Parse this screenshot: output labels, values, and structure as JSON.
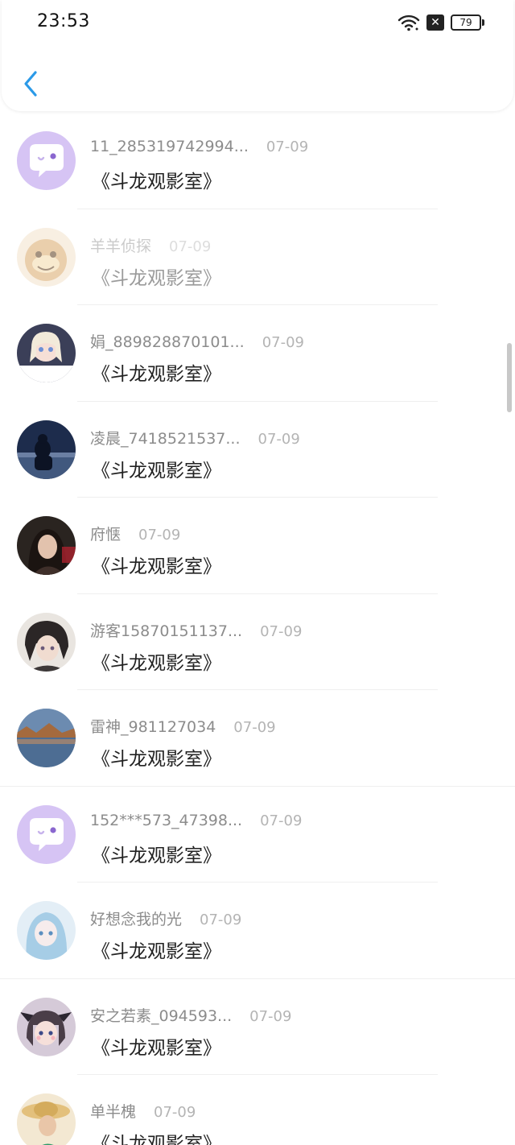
{
  "status_bar": {
    "time": "23:53",
    "battery": "79",
    "sim_mark": "✕"
  },
  "header": {
    "back_icon": "chevron-left-icon"
  },
  "items": [
    {
      "username": "11_285319742994...",
      "date": "07-09",
      "message": "《斗龙观影室》",
      "avatar": "chat-bubble"
    },
    {
      "username": "羊羊侦探",
      "date": "07-09",
      "message": "《斗龙观影室》",
      "avatar": "cartoon"
    },
    {
      "username": "娟_889828870101...",
      "date": "07-09",
      "message": "《斗龙观影室》",
      "avatar": "doll"
    },
    {
      "username": "凌晨_7418521537...",
      "date": "07-09",
      "message": "《斗龙观影室》",
      "avatar": "night-silhouette"
    },
    {
      "username": "府惬",
      "date": "07-09",
      "message": "《斗龙观影室》",
      "avatar": "portrait-dark"
    },
    {
      "username": "游客15870151137...",
      "date": "07-09",
      "message": "《斗龙观影室》",
      "avatar": "anime-boy"
    },
    {
      "username": "雷神_981127034",
      "date": "07-09",
      "message": "《斗龙观影室》",
      "avatar": "lake-landscape"
    },
    {
      "username": "152***573_47398...",
      "date": "07-09",
      "message": "《斗龙观影室》",
      "avatar": "chat-bubble"
    },
    {
      "username": "好想念我的光",
      "date": "07-09",
      "message": "《斗龙观影室》",
      "avatar": "anime-girl-blue"
    },
    {
      "username": "安之若素_094593...",
      "date": "07-09",
      "message": "《斗龙观影室》",
      "avatar": "anime-girl-bow"
    },
    {
      "username": "单半槐",
      "date": "07-09",
      "message": "《斗龙观影室》",
      "avatar": "girl-hat"
    }
  ],
  "colors": {
    "accent": "#2b9ae8",
    "username": "#8c8c8c",
    "date": "#b4b4b4",
    "message": "#222222",
    "default_avatar": "#d9c6f5"
  }
}
